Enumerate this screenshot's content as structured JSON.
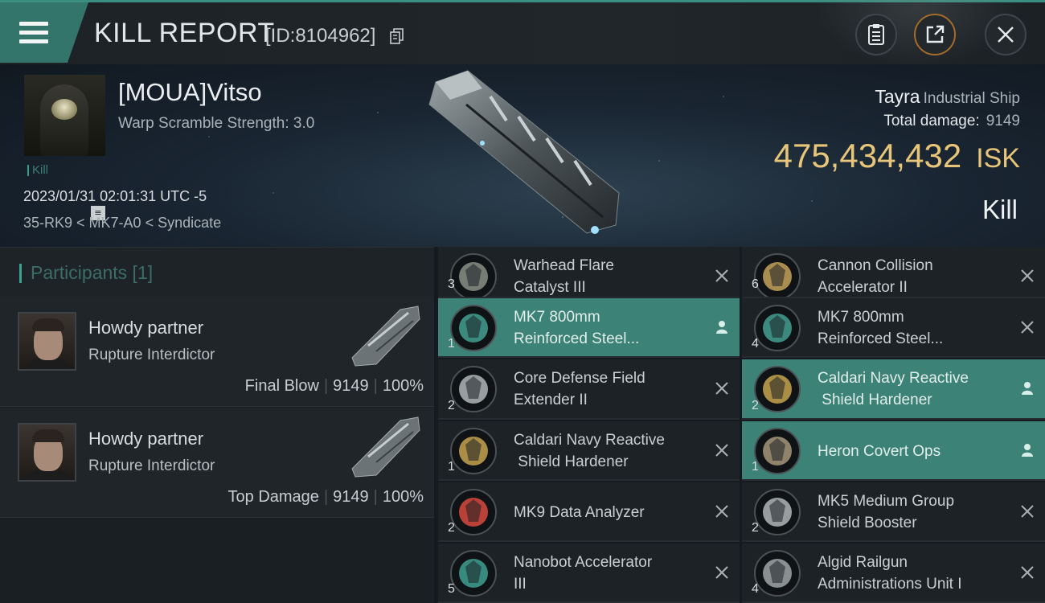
{
  "header": {
    "title": "KILL REPORT",
    "report_id": "[ID:8104962]",
    "icons": [
      "menu-icon",
      "copy-icon",
      "clipboard-icon",
      "share-icon",
      "close-icon"
    ]
  },
  "victim": {
    "name": "[MOUA]Vitso",
    "warp_scramble": "Warp Scramble Strength: 3.0",
    "tag": "Kill",
    "datetime": "2023/01/31 02:01:31 UTC -5",
    "location": "35-RK9 < MK7-A0 < Syndicate",
    "ship_name": "Tayra",
    "ship_class": "Industrial Ship",
    "total_damage_label": "Total damage:",
    "total_damage": "9149",
    "isk_value": "475,434,432",
    "isk_unit": "ISK",
    "result": "Kill"
  },
  "participants": {
    "title": "Participants [1]",
    "cards": [
      {
        "name": "Howdy partner",
        "ship": "Rupture Interdictor",
        "role": "Final Blow",
        "damage": "9149",
        "percent": "100%"
      },
      {
        "name": "Howdy partner",
        "ship": "Rupture Interdictor",
        "role": "Top Damage",
        "damage": "9149",
        "percent": "100%"
      }
    ]
  },
  "modules": {
    "left": [
      {
        "line1": "Warhead Flare",
        "line2": "Catalyst III",
        "qty": "3",
        "status": "destroyed"
      },
      {
        "line1": "MK7 800mm",
        "line2": "Reinforced Steel...",
        "qty": "1",
        "status": "dropped"
      },
      {
        "line1": "Core Defense Field",
        "line2": "Extender II",
        "qty": "2",
        "status": "destroyed"
      },
      {
        "line1": "Caldari Navy Reactive",
        "line2": " Shield Hardener",
        "qty": "1",
        "status": "destroyed"
      },
      {
        "line1": "MK9 Data Analyzer",
        "line2": "",
        "qty": "2",
        "status": "destroyed"
      },
      {
        "line1": "Nanobot Accelerator",
        "line2": "III",
        "qty": "5",
        "status": "destroyed"
      }
    ],
    "right": [
      {
        "line1": "Cannon Collision",
        "line2": "Accelerator II",
        "qty": "6",
        "status": "destroyed"
      },
      {
        "line1": "MK7 800mm",
        "line2": "Reinforced Steel...",
        "qty": "4",
        "status": "destroyed"
      },
      {
        "line1": "Caldari Navy Reactive",
        "line2": " Shield Hardener",
        "qty": "2",
        "status": "dropped"
      },
      {
        "line1": "Heron Covert Ops",
        "line2": "",
        "qty": "1",
        "status": "dropped"
      },
      {
        "line1": "MK5 Medium Group",
        "line2": "Shield Booster",
        "qty": "2",
        "status": "destroyed"
      },
      {
        "line1": "Algid Railgun",
        "line2": "Administrations Unit I",
        "qty": "4",
        "status": "destroyed"
      }
    ]
  },
  "colors": {
    "accent_teal": "#3c8276",
    "isk_gold": "#e8c679",
    "orange_button": "#a46b2c"
  }
}
